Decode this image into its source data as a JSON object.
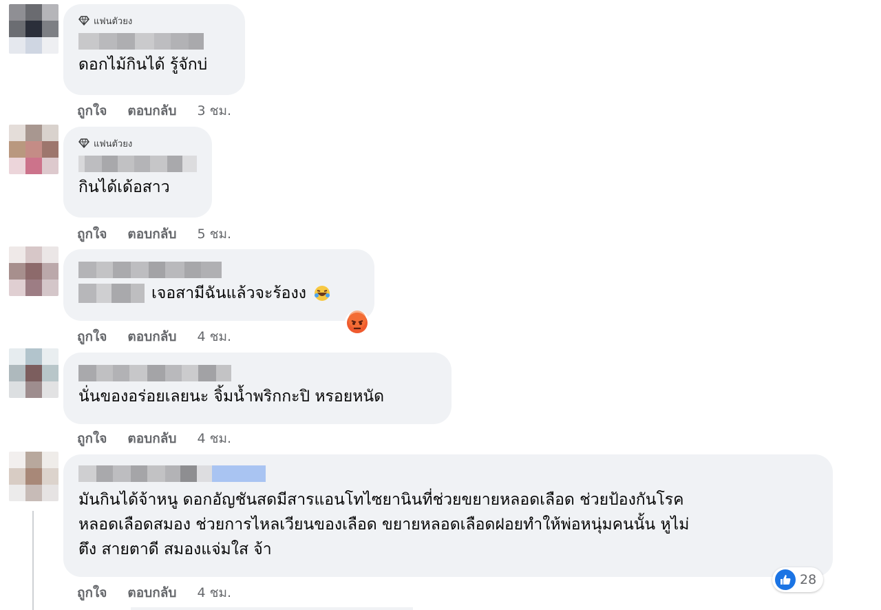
{
  "comments": [
    {
      "badge": "แฟนตัวยง",
      "text": "ดอกไม้กินได้ รู้จักบ่",
      "like": "ถูกใจ",
      "reply": "ตอบกลับ",
      "time": "3 ชม."
    },
    {
      "badge": "แฟนตัวยง",
      "text": "กินได้เด้อสาว",
      "like": "ถูกใจ",
      "reply": "ตอบกลับ",
      "time": "5 ชม."
    },
    {
      "text": "เจอสามีฉันแล้วจะร้องง",
      "like": "ถูกใจ",
      "reply": "ตอบกลับ",
      "time": "4 ชม."
    },
    {
      "text": "นั่นของอร่อยเลยนะ จิ้มน้ำพริกกะปิ หรอยหนัด",
      "like": "ถูกใจ",
      "reply": "ตอบกลับ",
      "time": "4 ชม."
    },
    {
      "text_lines": [
        "มันกินได้จ้าหนู ดอกอัญชันสดมีสารแอนโทไซยานินที่ช่วยขยายหลอดเลือด ช่วยป้องกันโรค",
        "หลอดเลือดสมอง ช่วยการไหลเวียนของเลือด ขยายหลอดเลือดฝอยทำให้พ่อหนุ่มคนนั้น หูไม่",
        "ตึง สายตาดี สมองแจ่มใส จ้า"
      ],
      "reaction_count": "28",
      "like": "ถูกใจ",
      "reply": "ตอบกลับ",
      "time": "4 ชม."
    }
  ],
  "icons": {
    "badge": "diamond-icon",
    "reaction_like": "thumbs-up-icon",
    "emoji_laugh": "rolling-laugh-emoji-icon",
    "emoji_angry": "angry-face-emoji-icon"
  },
  "colors": {
    "bubble": "#f0f2f5",
    "secondary_text": "#65676b",
    "like_blue": "#1b74e4"
  }
}
